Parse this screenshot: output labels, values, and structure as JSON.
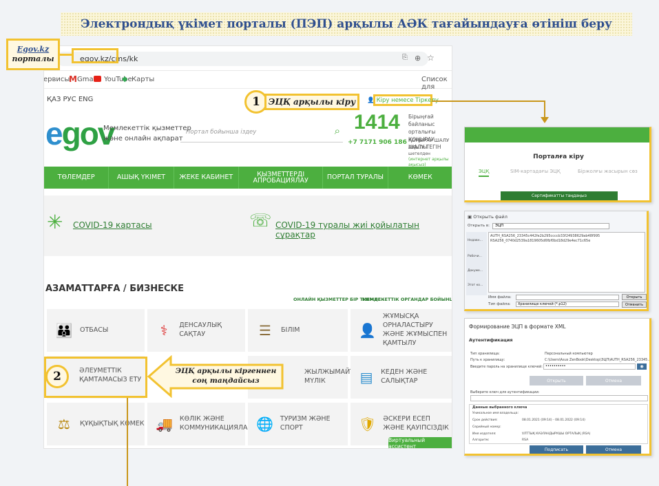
{
  "title": "Электрондық үкімет порталы (ПЭП) арқылы АӘК тағайындауға өтініш беру",
  "callout_portal": {
    "line1": "Egov.kz",
    "line2": "порталы"
  },
  "browser": {
    "address": "egov.kz/cms/kk",
    "bookmarks": [
      "Сервисы",
      "Gmail",
      "YouTube",
      "Карты"
    ],
    "reading_list": "Список для"
  },
  "site": {
    "langs": "ҚАЗ  РУС  ENG",
    "login": "Кіру немесе Тіркелу",
    "logo_text": "egov",
    "logo_caption_1": "Мемлекеттік қызметтер",
    "logo_caption_2": "және онлайн ақпарат",
    "search_placeholder": "Портал бойынша іздеу",
    "phone_big": "1414",
    "phone_big_text_1": "Бірыңғай байланыс орталығы",
    "phone_big_text_2": "ҚОҢЫРАУ ШАЛУ ТЕГІН",
    "phone_small": "+7 7171 906 186",
    "phone_small_text_1": "ҚОҢЫРАУ ШАЛУ АҚЫЛЫ",
    "phone_small_text_2": "шетелден",
    "phone_small_text_3": "(интернет арқылы ақысыз)",
    "nav": [
      "ТӨЛЕМДЕР",
      "АШЫҚ ҮКІМЕТ",
      "ЖЕКЕ КАБИНЕТ",
      "ҚЫЗМЕТТЕРДІ АПРОБАЦИЯЛАУ",
      "ПОРТАЛ ТУРАЛЫ",
      "КӨМЕК"
    ],
    "covid_map": "COVID-19 картасы",
    "covid_faq": "COVID-19 туралы жиі қойылатын сұрақтар",
    "section_title": "АЗАМАТТАРҒА / БИЗНЕСКЕ",
    "online_link": "ОНЛАЙН ҚЫЗМЕТТЕР БІР ТІЗІМДЕ ›",
    "gov_link": "МЕМЛЕКЕТТІК ОРГАНДАР БОЙЫНША ҚЫЗМЕТТЕР ›",
    "tiles": [
      "ОТБАСЫ",
      "ДЕНСАУЛЫҚ САҚТАУ",
      "БІЛІМ",
      "ЖҰМЫСҚА ОРНАЛАСТЫРУ ЖӘНЕ ЖҰМЫСПЕН ҚАМТЫЛУ",
      "ӘЛЕУМЕТТІК ҚАМТАМАСЫЗ ЕТУ",
      "ЖЫЛЖЫМАЙТЫН МҮЛІК",
      "КЕДЕН ЖӘНЕ САЛЫҚТАР",
      "ҚҰҚЫҚТЫҚ КӨМЕК",
      "КӨЛІК ЖӘНЕ КОММУНИКАЦИЯЛАР",
      "ТУРИЗМ ЖӘНЕ СПОРТ",
      "ӘСКЕРИ ЕСЕП ЖӘНЕ ҚАУІПСІЗДІК"
    ],
    "virtual_assistant": "Виртуальный ассистент"
  },
  "step1": {
    "num": "1",
    "label": "ЭЦҚ арқылы кіру"
  },
  "step2": {
    "num": "2",
    "label_1": "ЭЦҚ арқылы кіргеннен",
    "label_2": "соң таңдайсыз"
  },
  "login_panel": {
    "title": "Порталға кіру",
    "tabs": [
      "ЭЦҚ",
      "SIM-картадағы ЭЦҚ",
      "Біржолғы жасырын сөз"
    ],
    "button": "Сертификатты таңдаңыз"
  },
  "file_dialog": {
    "title": "Открыть файл",
    "folder_label": "Открыть в:",
    "folder": "ЭЦП",
    "files": [
      "AUTH_RSA256_23345c442fe2b295ccccb33f24938629ab48f995",
      "RSA256_0740d2539a1819605d6fbf0bd18d29e4ec71c65e"
    ],
    "places": [
      "Недавн...",
      "Рабочи...",
      "Докуме...",
      "Этот ко...",
      "Сеть"
    ],
    "name_label": "Имя файла:",
    "type_label": "Тип файла:",
    "type_value": "Хранилище ключей (*.p12)",
    "open": "Открыть",
    "cancel": "Отменить"
  },
  "xml_panel": {
    "title": "Формирование ЭЦП в формате XML",
    "section": "Аутентификация",
    "rows": [
      [
        "Тип хранилища:",
        "Персональный компьютер"
      ],
      [
        "Путь к хранилищу:",
        "C:\\Users\\Asus ZenBook\\Desktop\\ЭЦП\\AUTH_RSA256_23345..."
      ],
      [
        "Введите пароль на хранилище ключей:",
        "••••••••••"
      ]
    ],
    "open": "Открыть",
    "cancel": "Отмена",
    "select_label": "Выберите ключ для аутентификации:",
    "key_section": "Данные выбранного ключа",
    "key_rows": [
      [
        "Уникальное имя владельца:",
        ""
      ],
      [
        "Срок действия:",
        "08.01.2021 (09:14) - 08.01.2022 (09:14)"
      ],
      [
        "Серийный номер:",
        ""
      ],
      [
        "Имя издателя:",
        "ҰЛТТЫҚ КУӘЛАНДЫРУШЫ ОРТАЛЫҚ (RSA)"
      ],
      [
        "Алгоритм:",
        "RSA"
      ]
    ],
    "sign": "Подписать",
    "cancel2": "Отмена"
  }
}
